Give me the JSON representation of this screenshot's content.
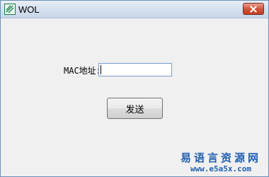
{
  "window": {
    "title": "WOL",
    "icon": "app-icon",
    "close_icon": "close-icon"
  },
  "form": {
    "mac_label": "MAC地址:",
    "mac_value": "",
    "send_label": "发送"
  },
  "watermark": {
    "cn_text": "易语言资源网",
    "url": "www.e5a5x.com"
  },
  "colors": {
    "titlebar": "#d7e2f0",
    "client_bg": "#f0f0f0",
    "close_button": "#c9442b",
    "input_border": "#7a9cd3",
    "watermark": "#1f5fb0"
  }
}
